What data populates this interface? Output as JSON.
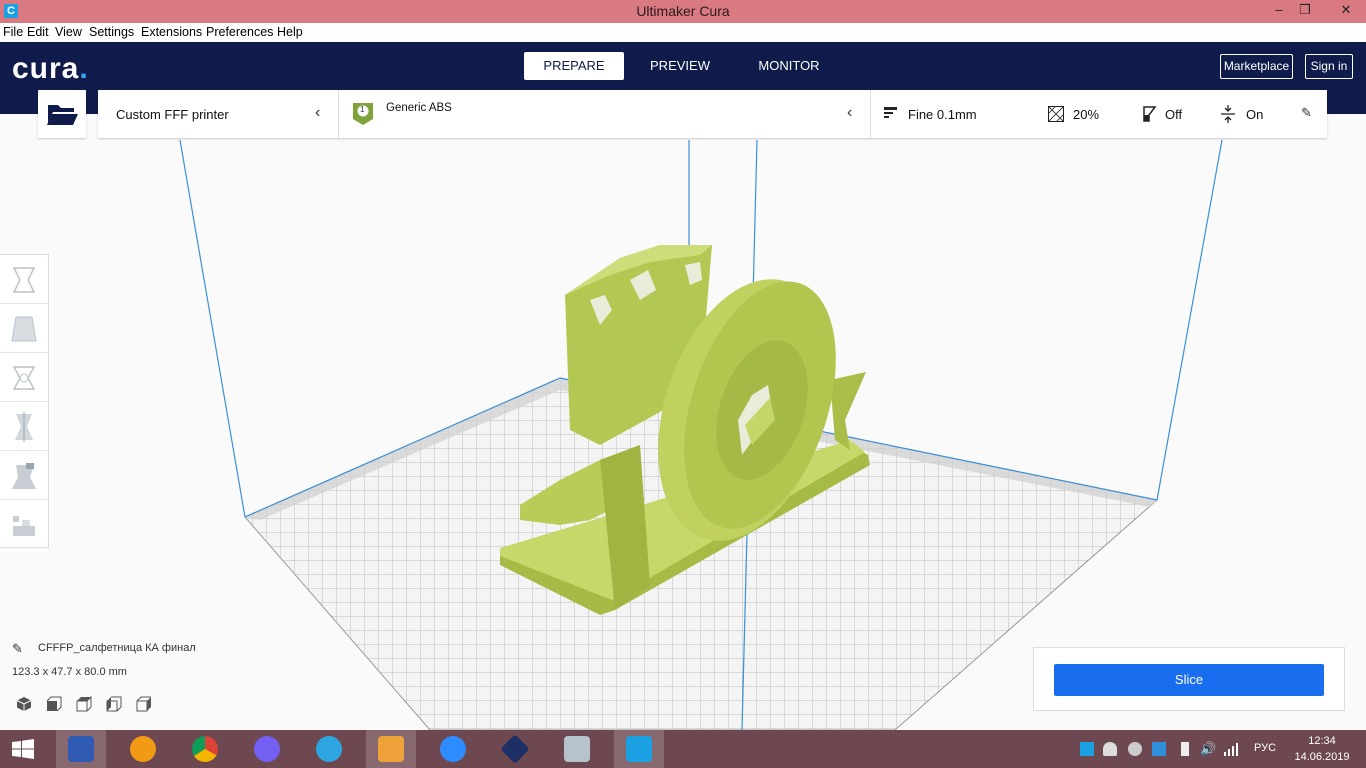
{
  "window": {
    "title": "Ultimaker Cura",
    "icon_letter": "C"
  },
  "menu": [
    "File",
    "Edit",
    "View",
    "Settings",
    "Extensions",
    "Preferences",
    "Help"
  ],
  "header": {
    "logo": "cura",
    "tabs": [
      {
        "label": "PREPARE",
        "active": true
      },
      {
        "label": "PREVIEW",
        "active": false
      },
      {
        "label": "MONITOR",
        "active": false
      }
    ],
    "marketplace": "Marketplace",
    "signin": "Sign in"
  },
  "config": {
    "printer": "Custom FFF printer",
    "extruder_number": "1",
    "material": "Generic ABS",
    "profile": "Fine 0.1mm",
    "infill": "20%",
    "support": "Off",
    "adhesion": "On"
  },
  "object": {
    "name": "CFFFP_салфетница КА финал",
    "dimensions": "123.3 x 47.7 x 80.0 mm"
  },
  "slice": {
    "label": "Slice"
  },
  "taskbar": {
    "language": "РУС",
    "time": "12:34",
    "date": "14.06.2019"
  },
  "colors": {
    "header": "#0f1b4a",
    "accent": "#196ef0",
    "model": "#bcd158",
    "titlebar": "#d97a82",
    "taskbar": "#6e4850"
  }
}
